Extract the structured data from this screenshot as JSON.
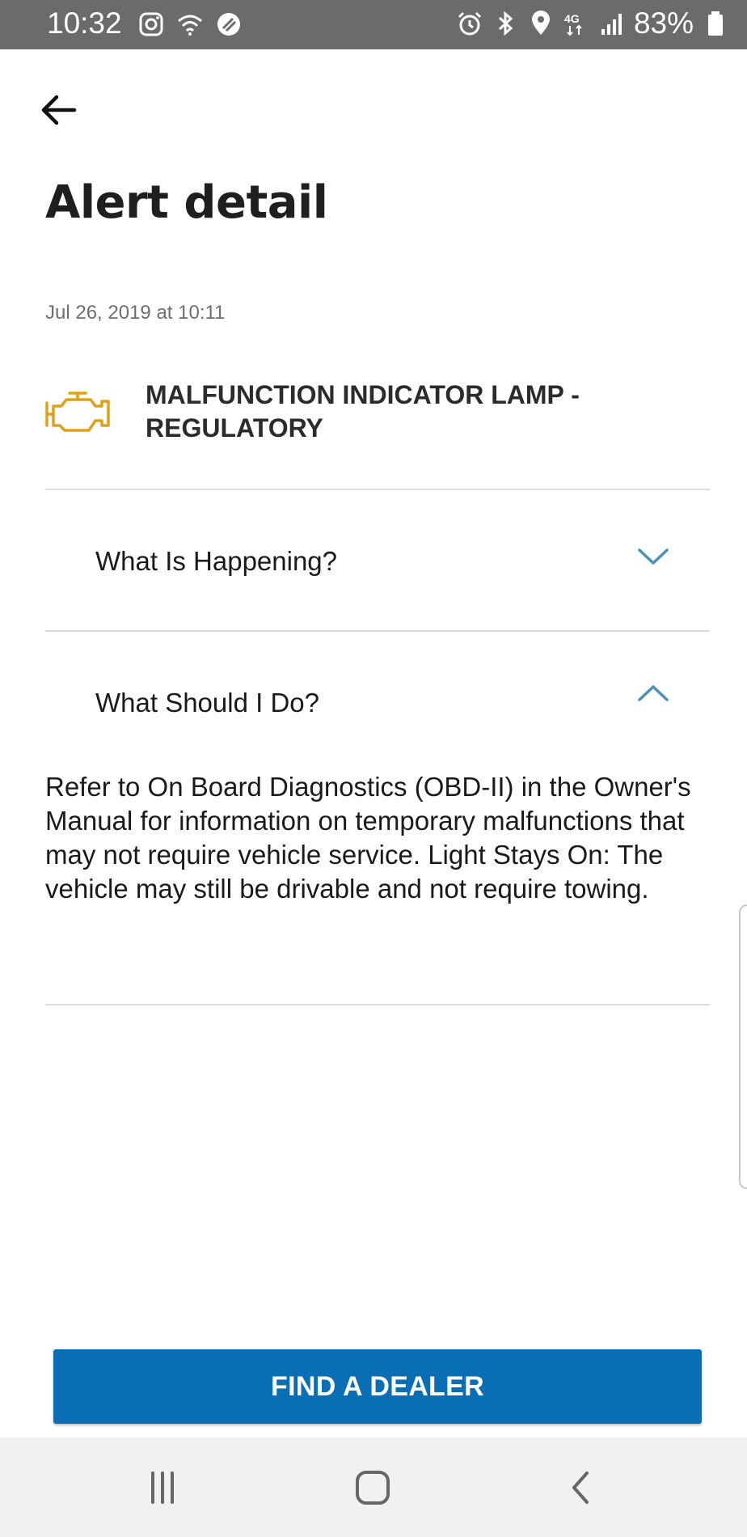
{
  "status_bar": {
    "time": "10:32",
    "battery_percent": "83%",
    "network": "4G",
    "icons_left": [
      "instagram-icon",
      "wifi-icon",
      "app-icon"
    ],
    "icons_right": [
      "alarm-icon",
      "bluetooth-icon",
      "location-icon",
      "lte-icon",
      "signal-icon",
      "battery-icon"
    ]
  },
  "header": {
    "back_icon": "arrow-left-icon",
    "title": "Alert detail"
  },
  "alert": {
    "date": "Jul 26, 2019 at 10:11",
    "icon": "check-engine-icon",
    "icon_color": "#e0a019",
    "name": "MALFUNCTION INDICATOR LAMP - REGULATORY"
  },
  "sections": [
    {
      "label": "What Is Happening?",
      "expanded": false
    },
    {
      "label": "What Should I Do?",
      "expanded": true,
      "content": "Refer to On Board Diagnostics (OBD-II) in the Owner's Manual for information on temporary malfunctions that may not require vehicle service. Light Stays On: The vehicle may still be drivable and not require towing."
    }
  ],
  "chevron_color": "#4a90b8",
  "action_button": {
    "label": "FIND A DEALER",
    "color": "#0a6eb4"
  },
  "nav_bar": {
    "buttons": [
      "recent-apps-icon",
      "home-icon",
      "back-icon"
    ]
  }
}
